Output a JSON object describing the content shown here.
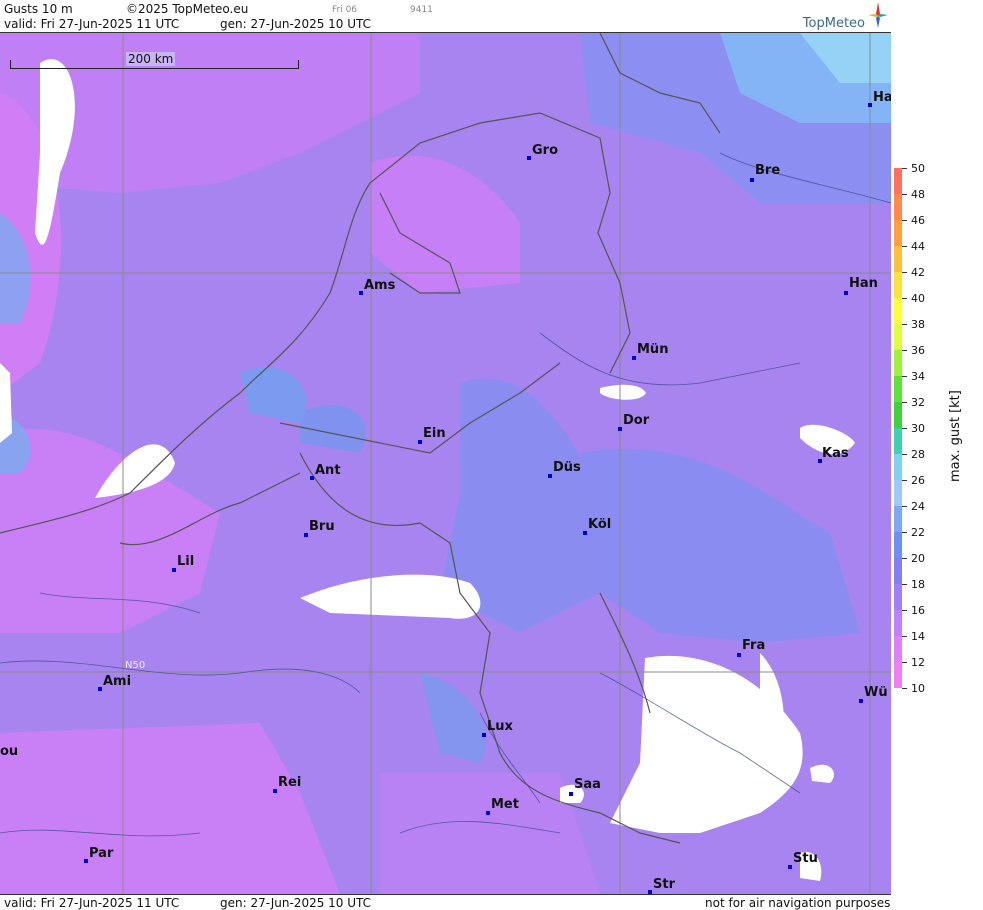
{
  "header": {
    "title": "Gusts 10 m",
    "copyright": "©2025 TopMeteo.eu",
    "day_label": "Fri 06",
    "code": "9411",
    "valid": "valid:  Fri  27-Jun-2025  11 UTC",
    "gen": "gen: 27-Jun-2025 10 UTC",
    "brand": "TopMeteo"
  },
  "footer": {
    "valid": "valid:  Fri  27-Jun-2025  11 UTC",
    "gen": "gen: 27-Jun-2025 10 UTC",
    "disclaimer": "not for air navigation purposes"
  },
  "map": {
    "scale_label": "200 km",
    "grid_label": "N50",
    "cities": [
      {
        "name": "Ha"
      },
      {
        "name": "Gro"
      },
      {
        "name": "Bre"
      },
      {
        "name": "Ams"
      },
      {
        "name": "Han"
      },
      {
        "name": "Mün"
      },
      {
        "name": "Dor"
      },
      {
        "name": "Ein"
      },
      {
        "name": "Kas"
      },
      {
        "name": "Ant"
      },
      {
        "name": "Düs"
      },
      {
        "name": "Bru"
      },
      {
        "name": "Köl"
      },
      {
        "name": "Lil"
      },
      {
        "name": "Fra"
      },
      {
        "name": "Ami"
      },
      {
        "name": "Wü"
      },
      {
        "name": "Lux"
      },
      {
        "name": "ou"
      },
      {
        "name": "Rei"
      },
      {
        "name": "Saa"
      },
      {
        "name": "Met"
      },
      {
        "name": "Par"
      },
      {
        "name": "Stu"
      },
      {
        "name": "Str"
      }
    ]
  },
  "legend": {
    "title": "max. gust [kt]",
    "ticks": [
      "50",
      "48",
      "46",
      "44",
      "42",
      "40",
      "38",
      "36",
      "34",
      "32",
      "30",
      "28",
      "26",
      "24",
      "22",
      "20",
      "18",
      "16",
      "14",
      "12",
      "10"
    ],
    "colors": [
      "#ff7060",
      "#ff8a50",
      "#ffa040",
      "#ffc040",
      "#ffe040",
      "#ffff40",
      "#e0ff40",
      "#a0f040",
      "#60e040",
      "#40d040",
      "#40d0b0",
      "#80d0f0",
      "#a0c8f8",
      "#80a8f0",
      "#7090f0",
      "#8080f0",
      "#a080f8",
      "#c080f8",
      "#e080f8",
      "#f080f0"
    ]
  }
}
